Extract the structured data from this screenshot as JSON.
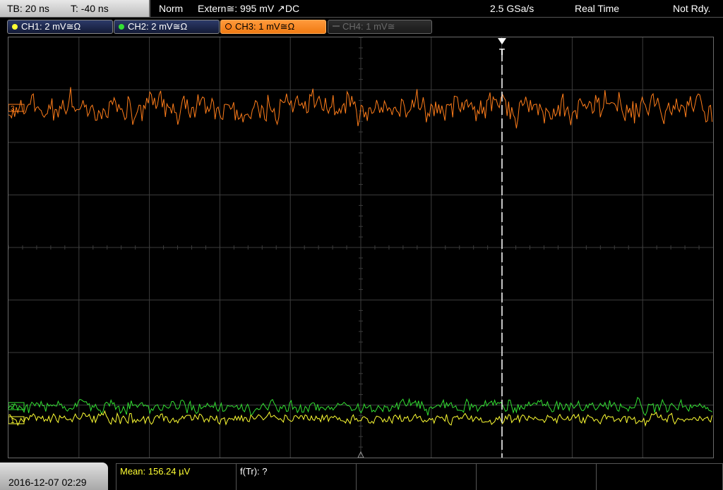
{
  "timebase": {
    "tb": "TB: 20 ns",
    "trigger_time": "T: -40 ns"
  },
  "status": {
    "mode": "Norm",
    "trigger_source": "Extern≅: 995 mV ↗DC",
    "sample_rate": "2.5 GSa/s",
    "acq_mode": "Real Time",
    "state": "Not Rdy."
  },
  "channels": [
    {
      "label": "CH1: 2 mV≅Ω",
      "color": "#ffff33",
      "state": "on"
    },
    {
      "label": "CH2: 2 mV≅Ω",
      "color": "#33e033",
      "state": "on"
    },
    {
      "label": "CH3: 1 mV≅Ω",
      "color": "#ff7d1a",
      "state": "active"
    },
    {
      "label": "CH4: 1 mV≅",
      "color": "#777777",
      "state": "off"
    }
  ],
  "trigger_marker": "T",
  "markers": {
    "ch3": "3",
    "ch2": "2",
    "ch1": "1"
  },
  "footer": {
    "datetime": "2016-12-07 02:29",
    "mean": "Mean: 156.24 µV",
    "f_tr": "f(Tr): ?"
  }
}
